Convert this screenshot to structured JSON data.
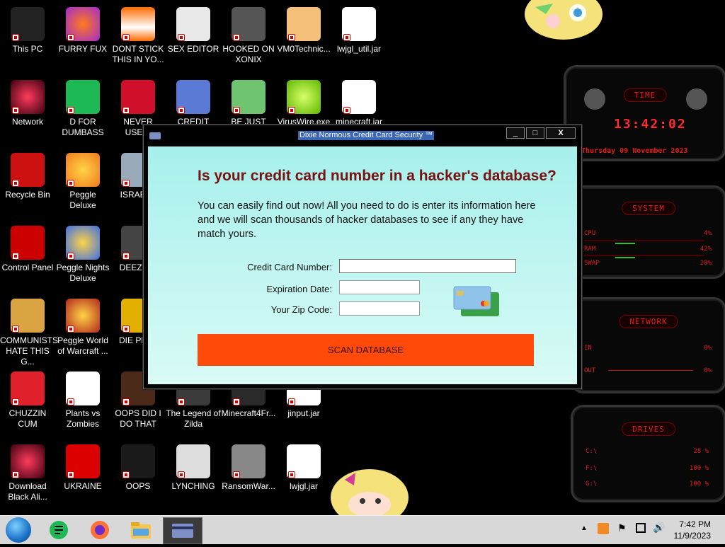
{
  "desktop": {
    "icons": [
      {
        "label": "This PC"
      },
      {
        "label": "FURRY FUX"
      },
      {
        "label": "DONT STICK THIS IN YO..."
      },
      {
        "label": "SEX EDITOR"
      },
      {
        "label": "HOOKED ON XONIX"
      },
      {
        "label": "VM0Technic..."
      },
      {
        "label": "lwjgl_util.jar"
      },
      {
        "label": "Network"
      },
      {
        "label": "D FOR DUMBASS"
      },
      {
        "label": "NEVER USED!"
      },
      {
        "label": "CREDIT CARD CHECKER"
      },
      {
        "label": "BE JUST LIKE THE DUDE!"
      },
      {
        "label": "VirusWire.exe"
      },
      {
        "label": "minecraft.jar"
      },
      {
        "label": "Recycle Bin"
      },
      {
        "label": "Peggle Deluxe"
      },
      {
        "label": "ISRAELS"
      },
      {
        "label": "Control Panel"
      },
      {
        "label": "Peggle Nights Deluxe"
      },
      {
        "label": "DEEZ NU"
      },
      {
        "label": "COMMUNISTS HATE THIS G..."
      },
      {
        "label": "Peggle World of Warcraft ..."
      },
      {
        "label": "DIE PLEA"
      },
      {
        "label": "CHUZZIN CUM"
      },
      {
        "label": "Plants vs Zombies"
      },
      {
        "label": "OOPS DID I DO THAT"
      },
      {
        "label": "The Legend of Zilda"
      },
      {
        "label": "Minecraft4Fr..."
      },
      {
        "label": "jinput.jar"
      },
      {
        "label": "Download Black Ali..."
      },
      {
        "label": "UKRAINE"
      },
      {
        "label": "OOPS"
      },
      {
        "label": "LYNCHING"
      },
      {
        "label": "RansomWar..."
      },
      {
        "label": "lwjgl.jar"
      }
    ]
  },
  "widget": {
    "time_title": "TIME",
    "time_value": "13:42:02",
    "date_value": "Thursday 09 November 2023",
    "system_title": "SYSTEM",
    "cpu_label": "CPU",
    "cpu_value": "4%",
    "ram_label": "RAM",
    "ram_value": "42%",
    "swap_label": "SWAP",
    "swap_value": "28%",
    "network_title": "NETWORK",
    "in_label": "IN",
    "in_value": "0%",
    "out_label": "OUT",
    "out_value": "0%",
    "drives_title": "DRIVES",
    "drive1_label": "C:\\",
    "drive1_value": "28 %",
    "drive2_label": "F:\\",
    "drive2_value": "100 %",
    "drive3_label": "G:\\",
    "drive3_value": "100 %"
  },
  "dialog": {
    "title": "Dixie Normous Credit Card Security ™",
    "heading": "Is your credit card number in a hacker's database?",
    "description": "You can easily find out now! All you need to do is enter its information here and we will scan thousands of hacker databases to see if any they have match yours.",
    "card_number_label": "Credit Card Number:",
    "card_number_value": "",
    "expiration_label": "Expiration Date:",
    "expiration_value": "",
    "zip_label": "Your Zip Code:",
    "zip_value": "",
    "scan_button": "SCAN DATABASE",
    "minimize": "_",
    "maximize": "□",
    "close": "X"
  },
  "taskbar": {
    "time": "7:42 PM",
    "date": "11/9/2023"
  },
  "colors": {
    "accent_red": "#e31c1c",
    "scan_button": "#ff4a0a",
    "dialog_bg": "#a7f0ec",
    "heading": "#7a1212"
  }
}
